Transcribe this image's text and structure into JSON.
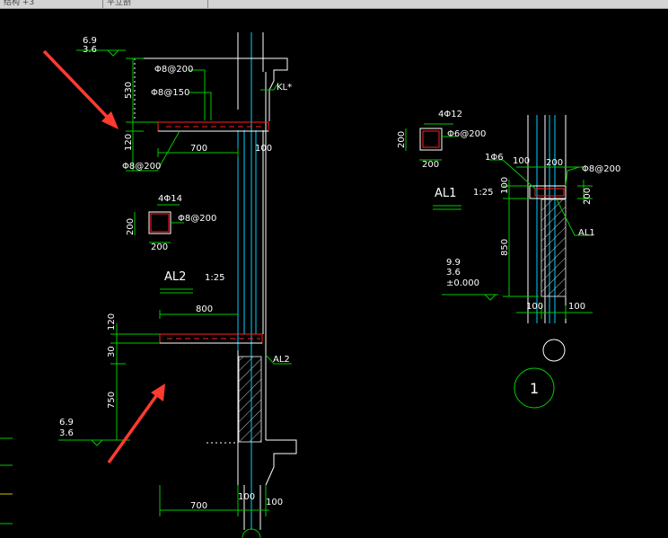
{
  "tabs": [
    {
      "label": "结构 +3"
    },
    {
      "label": "平立剖"
    }
  ],
  "colors": {
    "background": "#000000",
    "dimension": "#00c800",
    "text": "#ffffff",
    "beam": "#ff2020",
    "structure": "#ffffff",
    "axis": "#00d0ff",
    "hatch": "#c8c8c8",
    "arrow": "#ff3b30"
  },
  "drawing": {
    "left_top_elev": {
      "top": "6.9",
      "bottom": "3.6"
    },
    "left_bottom_elev": {
      "top": "6.9",
      "bottom": "3.6"
    },
    "right_elev": {
      "a": "9.9",
      "b": "3.6",
      "c": "±0.000"
    },
    "labels": {
      "stirrup_top": "Φ8@200",
      "rebar_mid": "Φ8@150",
      "kl": "KL*",
      "dim_530": "530",
      "dim_120a": "120",
      "dim_700a": "700",
      "dim_100a": "100",
      "rebar_bottom": "Φ8@200",
      "sec_4phi14": "4Φ14",
      "sec_stirrup_l": "Φ8@200",
      "sec_200h_l": "200",
      "sec_200w_l": "200",
      "al2_title": "AL2",
      "slope_l": "1:25",
      "dim_800": "800",
      "dim_120b": "120",
      "dim_30": "30",
      "dim_750": "750",
      "a_l2": "AL2",
      "dim_700b": "700",
      "dim_100b": "100",
      "dim_100c": "100",
      "sec_4phi12": "4Φ12",
      "sec_stirrup_r": "Φ6@200",
      "sec_200h_r": "200",
      "sec_200w_r": "200",
      "phi6": "1Φ6",
      "dim_100d": "100",
      "dim_200a": "200",
      "rebar_r": "Φ8@200",
      "al1_title": "AL1",
      "slope_r": "1:25",
      "dim_200b": "200",
      "a_l1": "AL1",
      "dim_850": "850",
      "dim_100e": "100",
      "dim_100f": "100",
      "axis_num": "1"
    }
  }
}
